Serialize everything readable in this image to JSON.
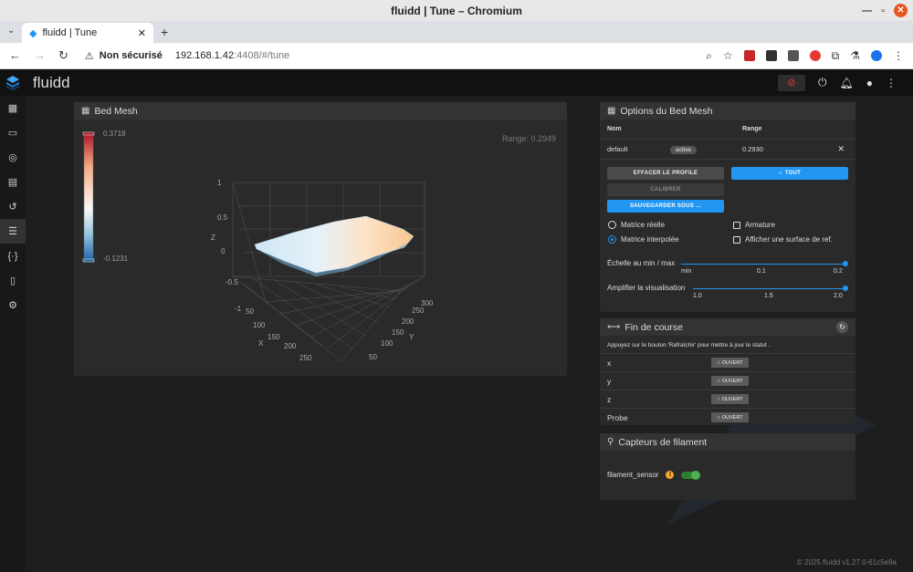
{
  "window": {
    "title": "fluidd | Tune – Chromium"
  },
  "browser": {
    "tab_title": "fluidd | Tune",
    "security_label": "Non sécurisé",
    "url_host": "192.168.1.42",
    "url_path": ":4408/#/tune"
  },
  "app": {
    "brand": "fluidd",
    "sidebar": [
      {
        "icon": "dashboard-icon"
      },
      {
        "icon": "console-icon"
      },
      {
        "icon": "camera-icon"
      },
      {
        "icon": "file-icon"
      },
      {
        "icon": "history-icon"
      },
      {
        "icon": "tune-icon",
        "active": true
      },
      {
        "icon": "config-braces-icon"
      },
      {
        "icon": "device-icon"
      },
      {
        "icon": "settings-icon"
      }
    ],
    "footer": "© 2025 fluidd v1.27.0-61c5e9a"
  },
  "bed_mesh": {
    "title": "Bed Mesh",
    "range_text": "Range: 0.2949",
    "scale_max": "0.3718",
    "scale_min": "-0.1231",
    "axes": {
      "z_label": "Z",
      "x_label": "X",
      "y_label": "Y",
      "z_ticks": [
        "1",
        "0.5",
        "0",
        "-0.5",
        "-1"
      ],
      "x_ticks": [
        "50",
        "100",
        "150",
        "200",
        "250"
      ],
      "y_ticks": [
        "50",
        "100",
        "150",
        "200",
        "250",
        "300"
      ]
    }
  },
  "options": {
    "title": "Options du Bed Mesh",
    "col_name": "Nom",
    "col_range": "Range",
    "profile": {
      "name": "default",
      "badge": "active",
      "range": "0.2930"
    },
    "btn_clear": "EFFACER LE PROFILE",
    "btn_home": "TOUT",
    "btn_calibrate": "CALIBRER",
    "btn_save": "SAUVEGARDER SOUS ...",
    "radio_real": "Matrice réelle",
    "radio_interp": "Matrice interpolée",
    "check_wireframe": "Armature",
    "check_flat": "Afficher une surface de ref.",
    "scale_label": "Échelle au min / max",
    "scale_ticks": [
      "min",
      "0.1",
      "0.2"
    ],
    "scale_value": 0.2,
    "amplify_label": "Amplifier la visualisation",
    "amplify_ticks": [
      "1.0",
      "1.5",
      "2.0"
    ],
    "amplify_value": 2.0
  },
  "endstops": {
    "title": "Fin de course",
    "description": "Appuyez sur le bouton 'Rafraîchir' pour mettre à jour le statut .",
    "rows": [
      {
        "name": "x",
        "state": "OUVERT"
      },
      {
        "name": "y",
        "state": "OUVERT"
      },
      {
        "name": "z",
        "state": "OUVERT"
      },
      {
        "name": "Probe",
        "state": "OUVERT"
      }
    ]
  },
  "filament": {
    "title": "Capteurs de filament",
    "sensor_name": "filament_sensor",
    "enabled": true
  },
  "colors": {
    "accent": "#2196f3",
    "estop": "#e53935",
    "toggle": "#4caf50",
    "warn": "#f9a825"
  }
}
